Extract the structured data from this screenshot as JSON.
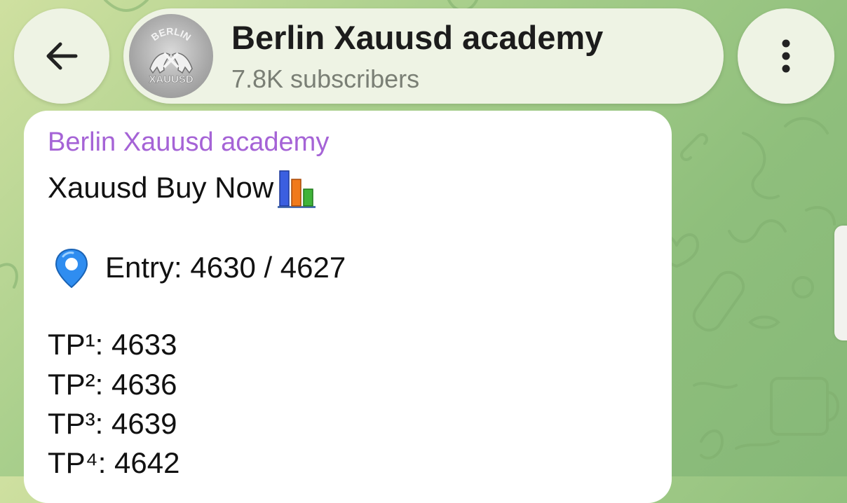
{
  "header": {
    "back_icon": "arrow-left-icon",
    "channel_name": "Berlin Xauusd academy",
    "subscribers": "7.8K subscribers",
    "avatar_top_text": "BERLIN",
    "avatar_bottom_text": "XAUUSD",
    "menu_icon": "more-vertical-icon"
  },
  "message": {
    "sender": "Berlin Xauusd academy",
    "headline": "Xauusd Buy Now",
    "headline_icon": "bar-chart-emoji-icon",
    "entry_icon": "map-pin-emoji-icon",
    "entry": "Entry: 4630 / 4627",
    "tp1": "TP¹: 4633",
    "tp2": "TP²: 4636",
    "tp3": "TP³: 4639",
    "tp4": "TP⁴: 4642"
  },
  "colors": {
    "sender_name": "#a563d6",
    "header_surface": "#eef3e4",
    "wallpaper": "#a9cf8c"
  }
}
